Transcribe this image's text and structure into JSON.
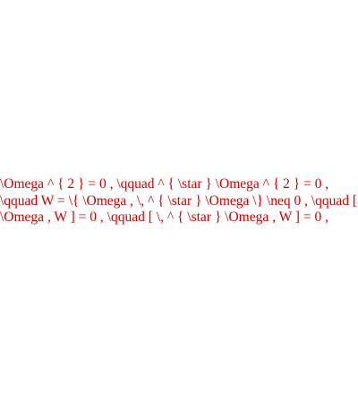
{
  "latex_source": "\\Omega ^ { 2 } = 0 , \\qquad ^ { \\star } \\Omega ^ { 2 } = 0 , \\qquad W = \\{ \\Omega , \\, ^ { \\star } \\Omega \\} \\neq 0 , \\qquad [ \\Omega , W ] = 0 , \\qquad [ \\, ^ { \\star } \\Omega , W ] = 0 ,",
  "colors": {
    "text": "#cc0000",
    "background": "#ffffff"
  }
}
